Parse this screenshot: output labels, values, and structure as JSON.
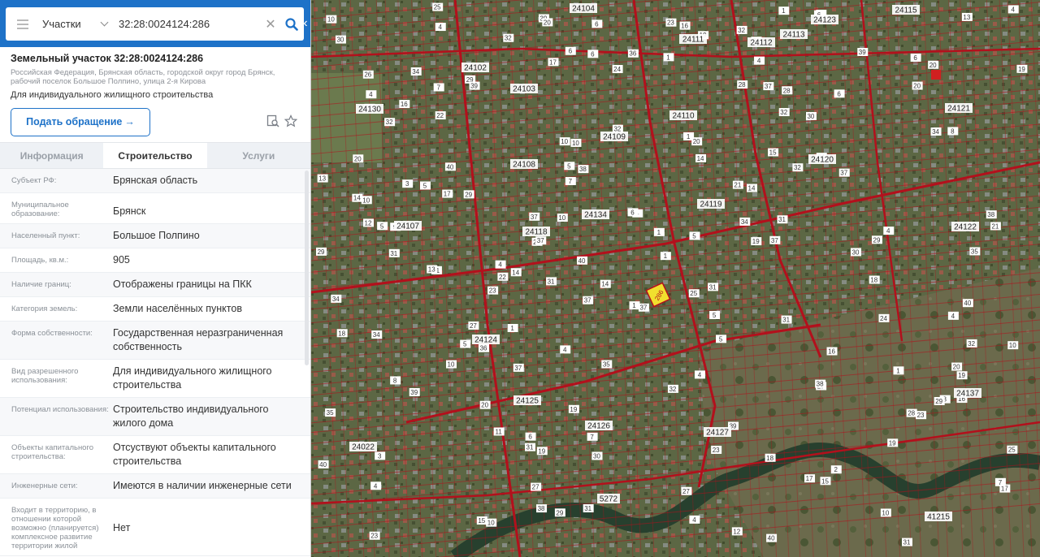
{
  "search": {
    "type_label": "Участки",
    "query": "32:28:0024124:286"
  },
  "parcel": {
    "title": "Земельный участок 32:28:0024124:286",
    "address": "Российская Федерация, Брянская область, городской округ город Брянск, рабочий поселок Большое Полпино, улица 2-я Кирова",
    "purpose": "Для индивидуального жилищного строительства",
    "apply_label": "Подать обращение"
  },
  "tabs": [
    "Информация",
    "Строительство",
    "Услуги"
  ],
  "properties": [
    {
      "label": "Субъект РФ:",
      "value": "Брянская область"
    },
    {
      "label": "Муниципальное образование:",
      "value": "Брянск"
    },
    {
      "label": "Населенный пункт:",
      "value": "Большое Полпино"
    },
    {
      "label": "Площадь, кв.м.:",
      "value": "905"
    },
    {
      "label": "Наличие границ:",
      "value": "Отображены границы на ПКК"
    },
    {
      "label": "Категория земель:",
      "value": "Земли населённых пунктов"
    },
    {
      "label": "Форма собственности:",
      "value": "Государственная неразграниченная собственность"
    },
    {
      "label": "Вид разрешенного использования:",
      "value": "Для индивидуального жилищного строительства"
    },
    {
      "label": "Потенциал использования:",
      "value": "Строительство индивидуального жилого дома"
    },
    {
      "label": "Объекты капитального строительства:",
      "value": "Отсуствуют объекты капитального строительства"
    },
    {
      "label": "Инженерные сети:",
      "value": "Имеются в наличии инженерные сети"
    },
    {
      "label": "Входит в территорию, в отношении которой возможно (планируется) комплексное развитие территории жилой",
      "value": "Нет"
    }
  ],
  "map": {
    "colors": {
      "parcel_border": "#b3101c",
      "selected": "#f1df2e",
      "terrain": "#58643d",
      "river": "#27402e"
    },
    "quarter_labels": [
      "24104",
      "24111",
      "24112",
      "24113",
      "24115",
      "24102",
      "24130",
      "24103",
      "24110",
      "24109",
      "24121",
      "24108",
      "24120",
      "24119",
      "24107",
      "24134",
      "24118",
      "24122",
      "24124",
      "24125",
      "24137",
      "24126",
      "24127",
      "24022",
      "5272",
      "41215",
      "24123"
    ],
    "selected_parcel_label": "286"
  }
}
